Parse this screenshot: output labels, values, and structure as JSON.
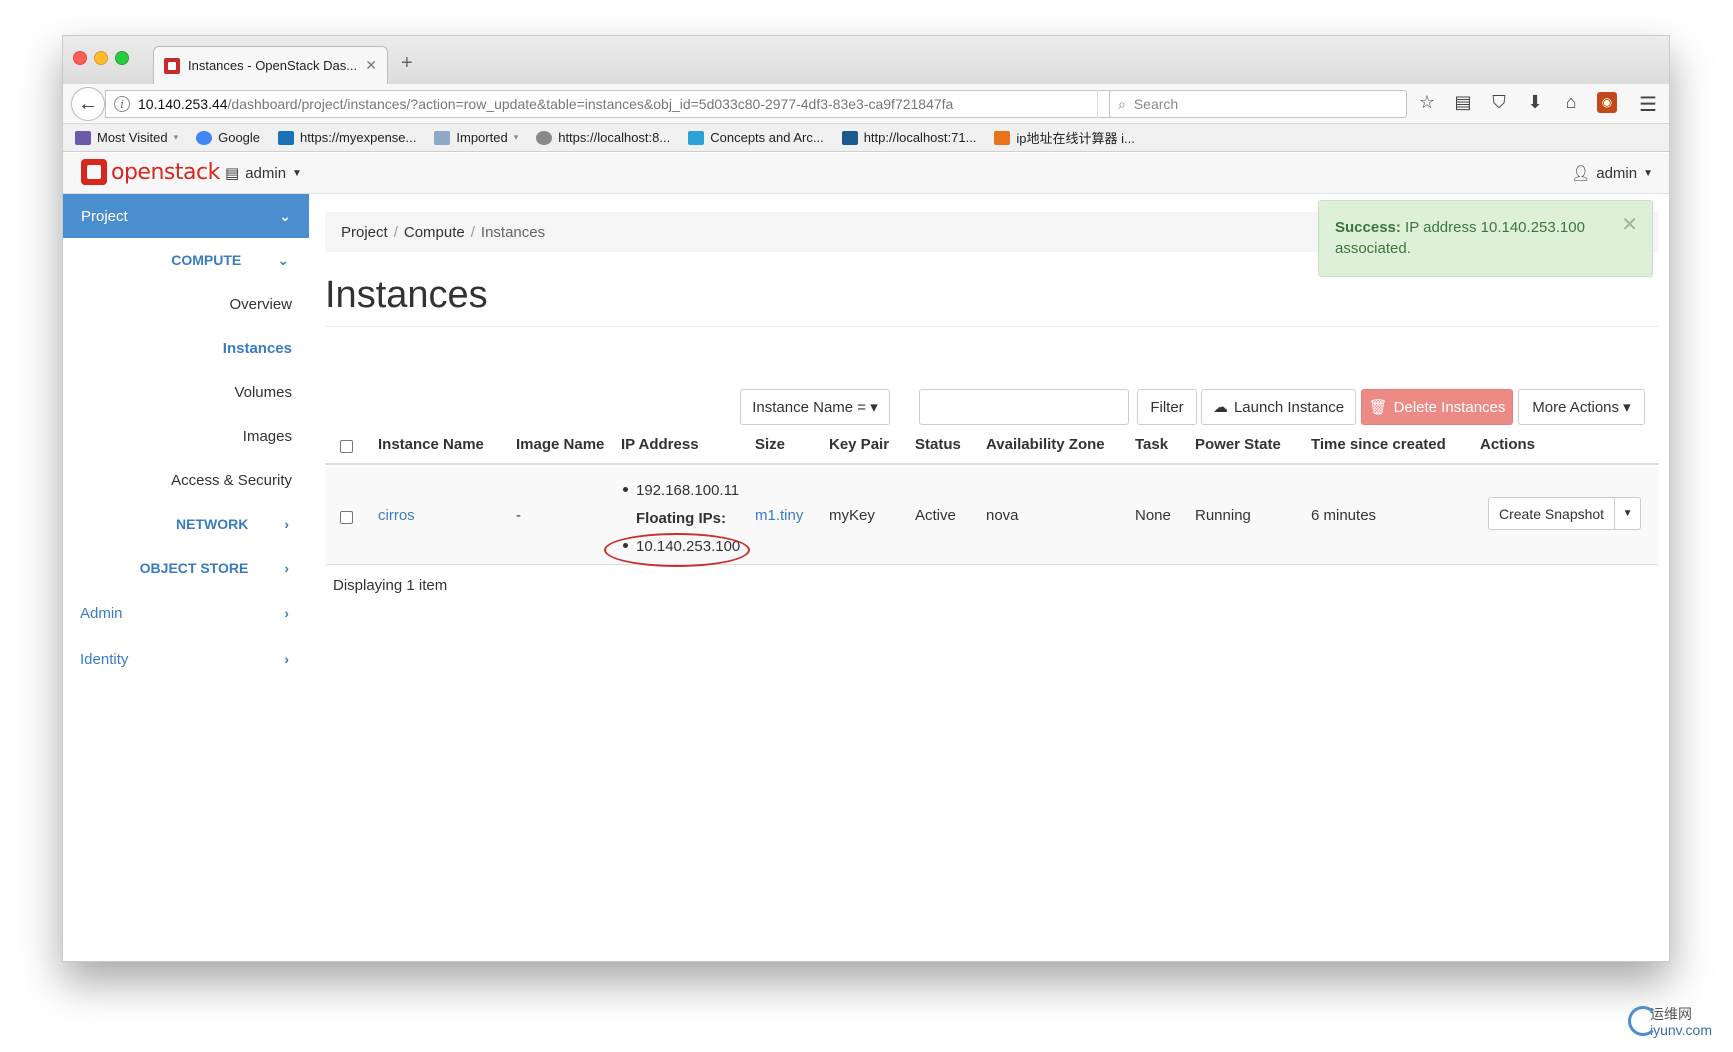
{
  "browser": {
    "tab_title": "Instances - OpenStack Das...",
    "url_host": "10.140.253.44",
    "url_path": "/dashboard/project/instances/?action=row_update&table=instances&obj_id=5d033c80-2977-4df3-83e3-ca9f721847fa",
    "search_placeholder": "Search",
    "bookmarks": [
      {
        "label": "Most Visited",
        "color": "#6b5aa8"
      },
      {
        "label": "Google",
        "color": "#4285f4"
      },
      {
        "label": "https://myexpense...",
        "color": "#1b72b8"
      },
      {
        "label": "Imported",
        "color": "#8ea9c8"
      },
      {
        "label": "https://localhost:8...",
        "color": "#888888"
      },
      {
        "label": "Concepts and Arc...",
        "color": "#2ba3d6"
      },
      {
        "label": "http://localhost:71...",
        "color": "#1a5a8c"
      },
      {
        "label": "ip地址在线计算器 i...",
        "color": "#e8731a"
      }
    ]
  },
  "header": {
    "logo_text": "openstack",
    "project": "admin",
    "user": "admin"
  },
  "sidebar": {
    "project": "Project",
    "compute": "COMPUTE",
    "items": [
      "Overview",
      "Instances",
      "Volumes",
      "Images",
      "Access & Security"
    ],
    "network": "NETWORK",
    "object_store": "OBJECT STORE",
    "admin": "Admin",
    "identity": "Identity"
  },
  "breadcrumb": {
    "project": "Project",
    "compute": "Compute",
    "current": "Instances"
  },
  "alert": {
    "strong": "Success:",
    "message": "IP address 10.140.253.100 associated."
  },
  "page_title": "Instances",
  "toolbar": {
    "filter_select": "Instance Name = ▾",
    "filter_button": "Filter",
    "launch": "Launch Instance",
    "delete": "Delete Instances",
    "more": "More Actions ▾"
  },
  "table": {
    "columns": [
      "Instance Name",
      "Image Name",
      "IP Address",
      "Size",
      "Key Pair",
      "Status",
      "Availability Zone",
      "Task",
      "Power State",
      "Time since created",
      "Actions"
    ],
    "row": {
      "name": "cirros",
      "image": "-",
      "fixed_ip": "192.168.100.11",
      "floating_label": "Floating IPs:",
      "floating_ip": "10.140.253.100",
      "size": "m1.tiny",
      "key_pair": "myKey",
      "status": "Active",
      "zone": "nova",
      "task": "None",
      "power": "Running",
      "age": "6 minutes",
      "action": "Create Snapshot"
    },
    "footer": "Displaying 1 item"
  },
  "watermark": {
    "cn": "运维网",
    "en": "iyunv.com"
  },
  "colors": {
    "accent": "#4a8ed0",
    "link": "#3b7cc0",
    "success_bg": "#dff0d8",
    "danger": "#ec8a86",
    "brand": "#d6281e"
  }
}
